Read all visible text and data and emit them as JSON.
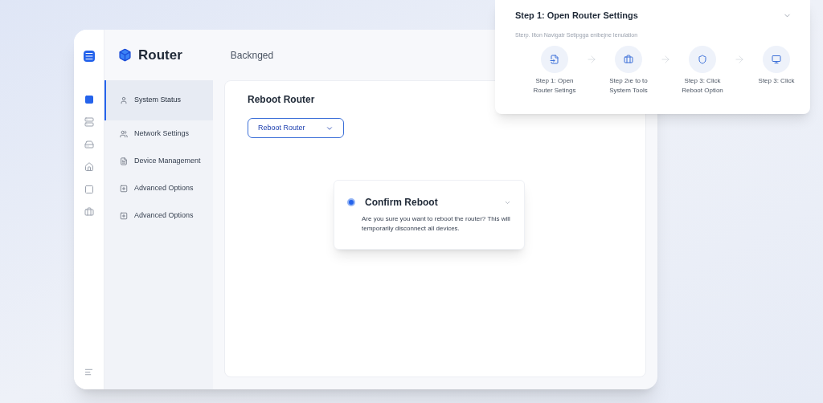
{
  "app": {
    "title": "Router",
    "breadcrumb": "Backnged"
  },
  "rail": [
    {
      "selected": true
    },
    {
      "selected": false
    },
    {
      "selected": false
    },
    {
      "selected": false
    },
    {
      "selected": false
    },
    {
      "selected": false
    }
  ],
  "sidebar": {
    "items": [
      {
        "label": "System Status",
        "selected": true
      },
      {
        "label": "Network Settings",
        "selected": false
      },
      {
        "label": "Device Management",
        "selected": false
      },
      {
        "label": "Advanced Options",
        "selected": false
      },
      {
        "label": "Advanced Options",
        "selected": false
      }
    ]
  },
  "content": {
    "title": "Reboot Router",
    "dropdown": {
      "value": "Reboot Router"
    }
  },
  "dialog": {
    "title": "Confirm Reboot",
    "message": "Are you sure you want to reboot the router? This will temporarily disconnect all devices."
  },
  "guide": {
    "title": "Step 1: Open Router Settings",
    "subtitle": "Sterp. Ilton Navigatr Setipgga enibejne Ienulation",
    "steps": [
      {
        "label": "Step 1: Open Router Setings"
      },
      {
        "label": "Step 2ıe to to System Tools"
      },
      {
        "label": "Step 3: Click Reboot Option"
      },
      {
        "label": "Step 3: Click"
      }
    ]
  }
}
